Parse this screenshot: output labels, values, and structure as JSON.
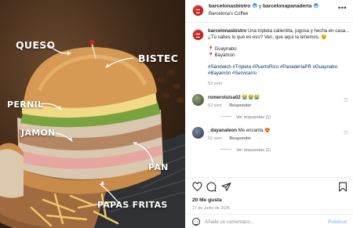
{
  "image": {
    "labels": {
      "queso": "QUESO",
      "bistec": "BISTEC",
      "pernil": "PERNIL",
      "jamon": "JAMÓN",
      "pan": "PAN",
      "papas": "PAPAS FRITAS"
    }
  },
  "header": {
    "user1": "barcelonasbistro",
    "connector": "y",
    "user2": "barcelonapanaderia",
    "subtitle": "Barcelona's Coffee",
    "more_icon": "more-horizontal-icon"
  },
  "caption": {
    "username": "barcelonasbistro",
    "text": "Una tripleta calientita, jugosa y hecha en casa... ¿Tú sabes lo que es eso? Ven, que aquí la tenemos. 😉",
    "locations": [
      "Guaynabo",
      "Bayamón"
    ],
    "hashtags": "#Sándwich #Tripleta #PuertoRico #PanaderíaPR #Guaynabo #Bayamón #Servicarro",
    "time": "52 sem"
  },
  "comments": [
    {
      "username": "romeroluisa02",
      "text": "😭😭😭",
      "time": "52 sem",
      "reply_label": "Responder",
      "view_replies": "Ver respuestas (1)"
    },
    {
      "username": "_dayanaleon",
      "text": "Me encanta 😍",
      "time": "52 sem",
      "reply_label": "Responder",
      "view_replies": "Ver respuestas (1)"
    }
  ],
  "actions": {
    "icons": [
      "heart-icon",
      "comment-icon",
      "share-icon",
      "bookmark-icon"
    ]
  },
  "likes": "20 Me gusta",
  "date": "17 de Junio de 2025",
  "add_comment": {
    "placeholder": "Añade un comentario...",
    "post_label": "Publicar"
  },
  "colors": {
    "accent_blue": "#3897f0",
    "post_disabled": "#95c8f6",
    "muted": "#8e8e8e"
  }
}
